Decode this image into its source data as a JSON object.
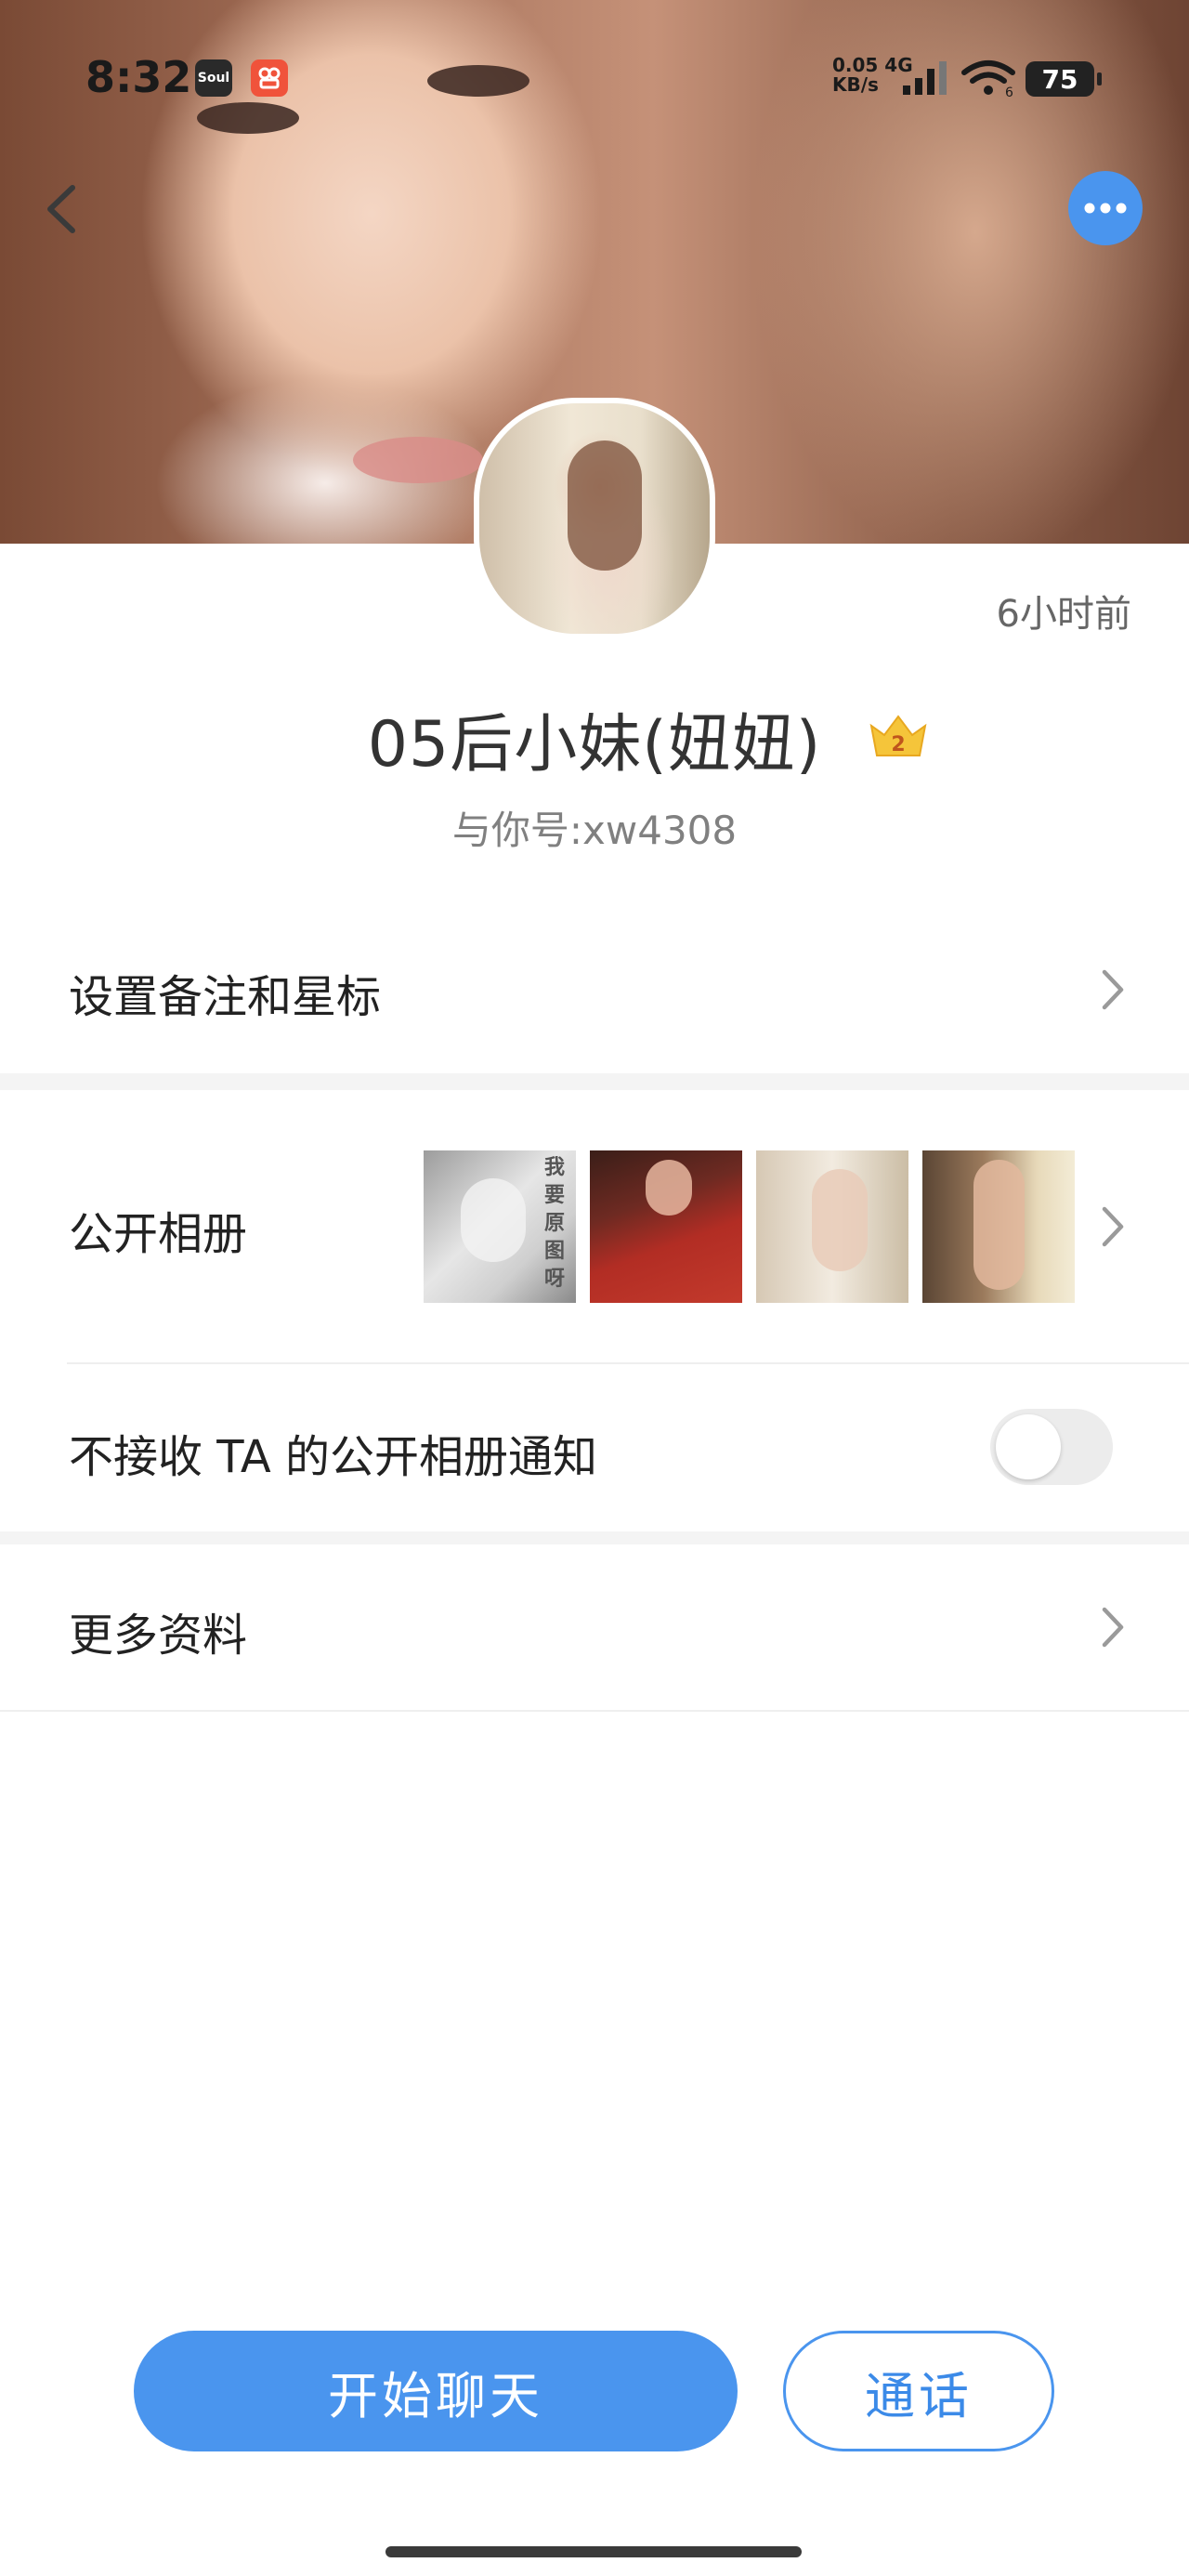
{
  "status_bar": {
    "time": "8:32",
    "apps": [
      "Soul",
      "小红书"
    ],
    "net_speed_top": "0.05 4G",
    "net_speed_bottom": "KB/s",
    "wifi_badge": "6",
    "battery": "75"
  },
  "header": {
    "back_icon": "chevron-left-icon",
    "more_icon": "more-dots-icon"
  },
  "profile": {
    "last_seen": "6小时前",
    "name": "05后小妹(妞妞)",
    "crown_level": "2",
    "user_id": "与你号:xw4308"
  },
  "menu": {
    "remark_label": "设置备注和星标",
    "album_label": "公开相册",
    "mute_label": "不接收 TA 的公开相册通知",
    "mute_enabled": false,
    "more_label": "更多资料"
  },
  "album_thumb_text": "我要原图呀",
  "actions": {
    "chat_label": "开始聊天",
    "call_label": "通话"
  },
  "colors": {
    "accent": "#4a95ee",
    "divider": "#efefef"
  }
}
